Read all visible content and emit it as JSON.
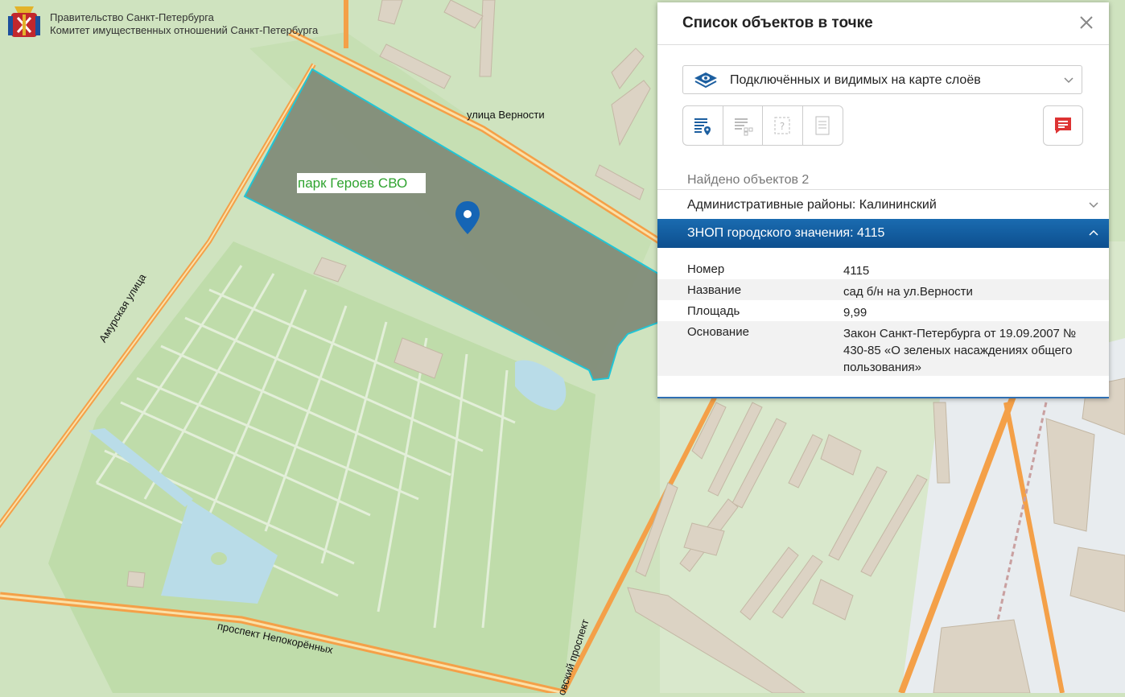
{
  "header": {
    "line1": "Правительство Санкт-Петербурга",
    "line2": "Комитет имущественных отношений Санкт-Петербурга"
  },
  "map": {
    "street_labels": {
      "vernosti": "улица Верности",
      "amurskaya": "Амурская улица",
      "nepokorennykh": "проспект Непокорённых",
      "prospekt_partial": "овский проспект"
    },
    "park_label": "парк Героев СВО"
  },
  "panel": {
    "title": "Список объектов в точке",
    "layer_select": "Подключённых и видимых на карте слоёв",
    "found": "Найдено объектов 2",
    "accordion": [
      {
        "label": "Административные районы: Калининский"
      },
      {
        "label": "ЗНОП городского значения: 4115"
      }
    ],
    "properties": [
      {
        "key": "Номер",
        "value": "4115"
      },
      {
        "key": "Название",
        "value": "сад б/н на ул.Верности"
      },
      {
        "key": "Площадь",
        "value": "9,99"
      },
      {
        "key": "Основание",
        "value": "Закон Санкт-Петербурга от 19.09.2007 № 430-85 «О зеленых насаждениях общего пользования»"
      }
    ]
  },
  "colors": {
    "selected_polygon_fill": "#7f8a77",
    "selected_polygon_outline": "#20c5d6",
    "accordion_active": "#1a6bb0",
    "marker": "#1565b5",
    "road_major": "#f4a048"
  }
}
